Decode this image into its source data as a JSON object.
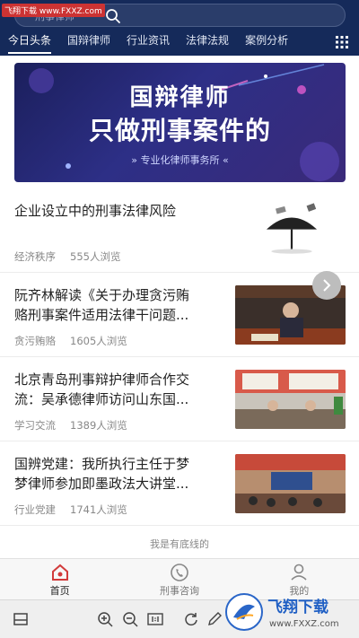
{
  "watermark": "飞翔下载 www.FXXZ.com",
  "search": {
    "placeholder": "刑事律师"
  },
  "tabs": [
    {
      "label": "今日头条"
    },
    {
      "label": "国辩律师"
    },
    {
      "label": "行业资讯"
    },
    {
      "label": "法律法规"
    },
    {
      "label": "案例分析"
    }
  ],
  "banner": {
    "line1": "国辩律师",
    "line2": "只做刑事案件的",
    "line3": "» 专业化律师事务所 «"
  },
  "articles": [
    {
      "title": "企业设立中的刑事法律风险",
      "category": "经济秩序",
      "views": "555人浏览"
    },
    {
      "title": "阮齐林解读《关于办理贪污贿赂刑事案件适用法律干问题...",
      "title_l1": "阮齐林解读《关于办理贪污贿",
      "title_l2": "赂刑事案件适用法律干问题...",
      "category": "贪污贿赂",
      "views": "1605人浏览"
    },
    {
      "title_l1": "北京青岛刑事辩护律师合作交",
      "title_l2": "流：吴承德律师访问山东国...",
      "category": "学习交流",
      "views": "1389人浏览"
    },
    {
      "title_l1": "国辨党建：我所执行主任于梦",
      "title_l2": "梦律师参加即墨政法大讲堂...",
      "category": "行业党建",
      "views": "1741人浏览"
    }
  ],
  "footer_note": "我是有底线的",
  "bottom_nav": [
    {
      "label": "首页",
      "icon": "home-icon",
      "active": true
    },
    {
      "label": "刑事咨询",
      "icon": "phone-icon",
      "active": false
    },
    {
      "label": "我的",
      "icon": "user-icon",
      "active": false
    }
  ],
  "logo_badge": {
    "text1": "飞翔下载",
    "text2": "www.FXXZ.com"
  },
  "colors": {
    "header": "#152a5a",
    "accent": "#d23b3b"
  }
}
